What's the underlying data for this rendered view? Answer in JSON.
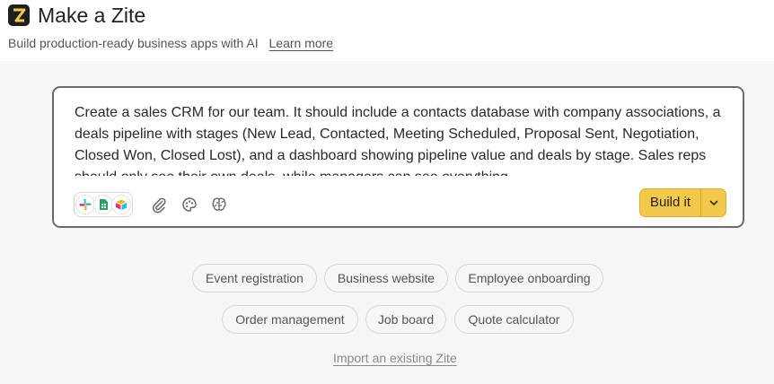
{
  "header": {
    "logo_icon": "zite-logo-icon",
    "title": "Make a Zite",
    "subtitle": "Build production-ready business apps with AI",
    "learn_more": "Learn more"
  },
  "prompt": {
    "text": "Create a sales CRM for our team. It should include a contacts database with company associations, a deals pipeline with stages (New Lead, Contacted, Meeting Scheduled, Proposal Sent, Negotiation, Closed Won, Closed Lost), and a dashboard showing pipeline value and deals by stage. Sales reps should only see their own deals, while managers can see everything."
  },
  "toolbar": {
    "integrations": [
      "slack-icon",
      "google-sheets-icon",
      "airtable-icon"
    ],
    "attach_icon": "paperclip-icon",
    "theme_icon": "palette-icon",
    "model_icon": "brain-icon"
  },
  "build": {
    "label": "Build it",
    "accent_color": "#f2c94c",
    "caret_icon": "chevron-down-icon"
  },
  "suggestions": [
    "Event registration",
    "Business website",
    "Employee onboarding",
    "Order management",
    "Job board",
    "Quote calculator"
  ],
  "import_link": "Import an existing Zite"
}
